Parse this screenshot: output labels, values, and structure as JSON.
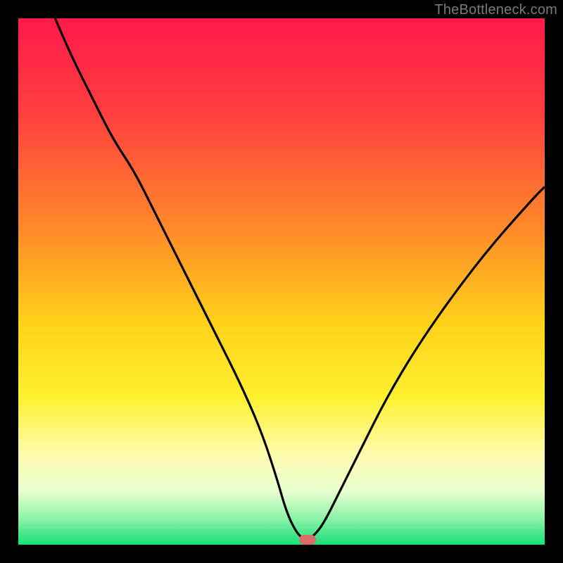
{
  "attribution": "TheBottleneck.com",
  "colors": {
    "frame_bg": "#000000",
    "curve_stroke": "#000000",
    "marker_fill": "#d96b6b",
    "gradient_stops": [
      {
        "pct": 0,
        "color": "#ff1a4b"
      },
      {
        "pct": 18,
        "color": "#ff3f3f"
      },
      {
        "pct": 40,
        "color": "#ff8a2a"
      },
      {
        "pct": 58,
        "color": "#ffd21a"
      },
      {
        "pct": 72,
        "color": "#fff030"
      },
      {
        "pct": 83,
        "color": "#fffcb0"
      },
      {
        "pct": 90,
        "color": "#e7ffd0"
      },
      {
        "pct": 95,
        "color": "#8cf2a8"
      },
      {
        "pct": 100,
        "color": "#18e07a"
      }
    ]
  },
  "chart_data": {
    "type": "line",
    "title": "",
    "xlabel": "",
    "ylabel": "",
    "xlim": [
      0,
      100
    ],
    "ylim": [
      0,
      100
    ],
    "series": [
      {
        "name": "bottleneck-curve",
        "x": [
          7,
          10,
          14,
          18,
          22,
          26,
          30,
          34,
          38,
          42,
          46,
          49,
          51,
          53,
          54.5,
          56,
          58,
          61,
          65,
          70,
          76,
          83,
          90,
          98,
          100
        ],
        "values": [
          100,
          93,
          85,
          77,
          71,
          63,
          55,
          47,
          39,
          31,
          22,
          13,
          6,
          2,
          1,
          1.5,
          4,
          10,
          18,
          28,
          38,
          48,
          57,
          66,
          68
        ]
      }
    ],
    "marker": {
      "x": 55,
      "y": 1
    },
    "grid": false,
    "legend": false
  }
}
